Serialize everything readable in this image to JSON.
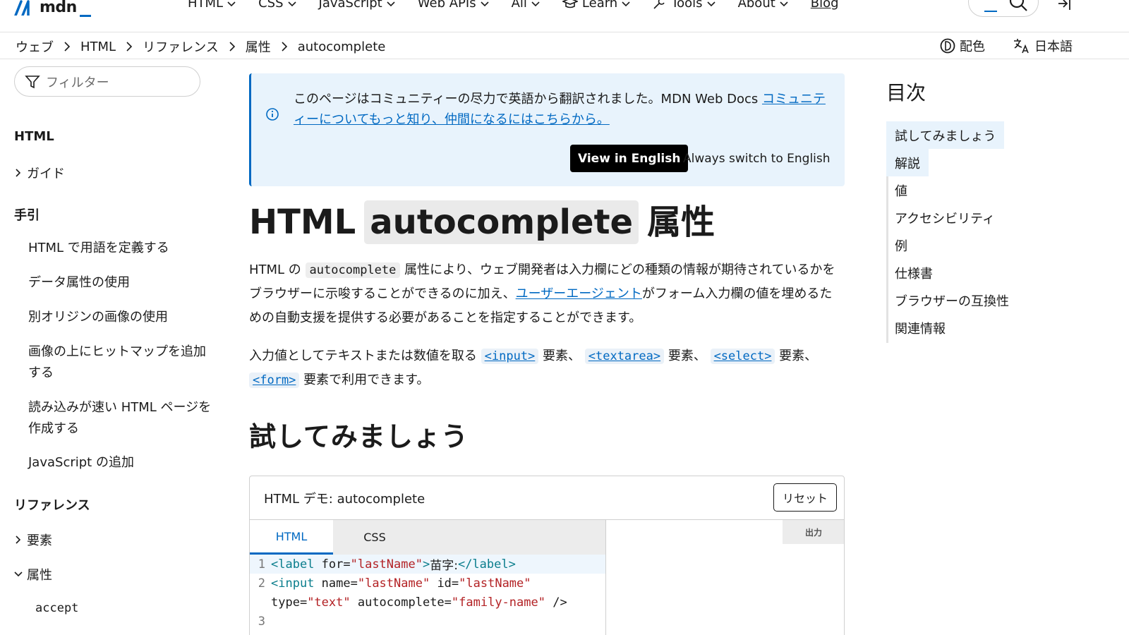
{
  "nav": {
    "logo_text": "mdn",
    "menu": [
      {
        "label": "HTML"
      },
      {
        "label": "CSS"
      },
      {
        "label": "JavaScript"
      },
      {
        "label": "Web APIs"
      },
      {
        "label": "All"
      },
      {
        "label": "Learn"
      },
      {
        "label": "Tools"
      },
      {
        "label": "About"
      }
    ],
    "blog": "Blog"
  },
  "breadcrumb": {
    "items": [
      "ウェブ",
      "HTML",
      "リファレンス",
      "属性",
      "autocomplete"
    ],
    "theme_label": "配色",
    "language_label": "日本語"
  },
  "sidebar": {
    "filter_placeholder": "フィルター",
    "section_html": "HTML",
    "guide": "ガイド",
    "section_tebiki": "手引",
    "tebiki_items": [
      "HTML で用語を定義する",
      "データ属性の使用",
      "別オリジンの画像の使用",
      "画像の上にヒットマップを追加する",
      "読み込みが速い HTML ページを作成する",
      "JavaScript の追加"
    ],
    "section_reference": "リファレンス",
    "elements": "要素",
    "attributes": "属性",
    "attr_first": "accept"
  },
  "notice": {
    "text": "このページはコミュニティーの尽力で英語から翻訳されました。MDN Web Docs ",
    "link": "コミュニティーについてもっと知り、仲間になるにはこちらから。",
    "view_english": "View in English",
    "always_switch": "Always switch to English"
  },
  "article": {
    "title_pre": "HTML",
    "title_code": "autocomplete",
    "title_post": "属性",
    "p1_a": "HTML の ",
    "p1_code": "autocomplete",
    "p1_b": " 属性により、ウェブ開発者は入力欄にどの種類の情報が期待されているかをブラウザーに示唆することができるのに加え、",
    "p1_link": "ユーザーエージェント",
    "p1_c": "がフォーム入力欄の値を埋めるための自動支援を提供する必要があることを指定することができます。",
    "p2_a": "入力値としてテキストまたは数値を取る ",
    "p2_input": "<input>",
    "p2_b": " 要素、 ",
    "p2_textarea": "<textarea>",
    "p2_c": " 要素、 ",
    "p2_select": "<select>",
    "p2_d": " 要素、 ",
    "p2_form": "<form>",
    "p2_e": " 要素で利用できます。",
    "h2": "試してみましょう"
  },
  "demo": {
    "title": "HTML デモ: autocomplete",
    "reset": "リセット",
    "tab_html": "HTML",
    "tab_css": "CSS",
    "output": "出力",
    "lines": {
      "l1": {
        "num": "1",
        "tag_open": "<label",
        "attr1": " for=",
        "str1": "\"lastName\"",
        "close": ">",
        "text": "苗字:",
        "tag_end": "</label",
        "close2": ">"
      },
      "l2": {
        "num": "2",
        "tag_open": "<input",
        "attr1": " name=",
        "str1": "\"lastName\"",
        "attr2": " id=",
        "str2": "\"lastName\""
      },
      "l2b": {
        "attr3": "type=",
        "str3": "\"text\"",
        "attr4": " autocomplete=",
        "str4": "\"family-name\"",
        "end": " />"
      },
      "l3": {
        "num": "3"
      }
    }
  },
  "toc": {
    "title": "目次",
    "items": [
      "試してみましょう",
      "解説",
      "値",
      "アクセシビリティ",
      "例",
      "仕様書",
      "ブラウザーの互換性",
      "関連情報"
    ]
  },
  "colors": {
    "accent": "#0069c2",
    "notice_bg": "#e8f3fc",
    "tag": "#0a7d8c",
    "string": "#b32225"
  }
}
